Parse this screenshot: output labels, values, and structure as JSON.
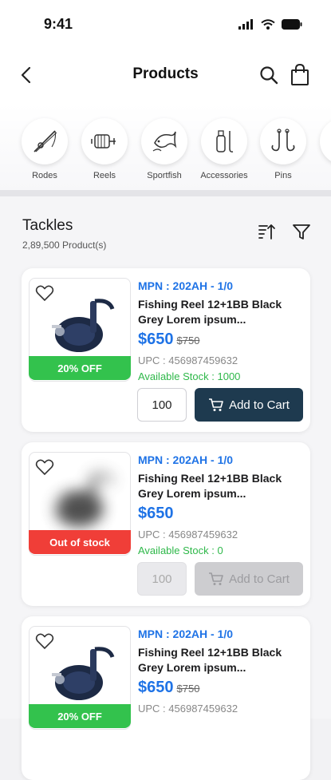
{
  "status_bar": {
    "time": "9:41"
  },
  "header": {
    "title": "Products"
  },
  "categories": [
    {
      "label": "Rodes",
      "icon": "fishing-rod-icon"
    },
    {
      "label": "Reels",
      "icon": "reel-icon"
    },
    {
      "label": "Sportfish",
      "icon": "fish-icon"
    },
    {
      "label": "Accessories",
      "icon": "accessories-icon"
    },
    {
      "label": "Pins",
      "icon": "hook-icon"
    }
  ],
  "section": {
    "title": "Tackles",
    "count": "2,89,500 Product(s)"
  },
  "products": [
    {
      "mpn": "MPN : 202AH - 1/0",
      "name_line1": "Fishing Reel 12+1BB Black",
      "name_line2": "Grey Lorem ipsum...",
      "price": "$650",
      "old_price": "$750",
      "upc": "UPC : 456987459632",
      "stock": "Available Stock : 1000",
      "badge": "20% OFF",
      "qty": "100",
      "cta": "Add to Cart"
    },
    {
      "mpn": "MPN : 202AH - 1/0",
      "name_line1": "Fishing Reel 12+1BB Black",
      "name_line2": "Grey Lorem ipsum...",
      "price": "$650",
      "upc": "UPC : 456987459632",
      "stock": "Available Stock : 0",
      "badge": "Out of stock",
      "qty": "100",
      "cta": "Add to Cart"
    },
    {
      "mpn": "MPN : 202AH - 1/0",
      "name_line1": "Fishing Reel 12+1BB Black",
      "name_line2": "Grey Lorem ipsum...",
      "price": "$650",
      "old_price": "$750",
      "upc": "UPC : 456987459632",
      "badge": "20% OFF"
    }
  ],
  "colors": {
    "accent_blue": "#1f73e6",
    "stock_green": "#2fb84a",
    "badge_green": "#33c24d",
    "badge_red": "#f03e38",
    "cart_button": "#1e3a4f"
  }
}
